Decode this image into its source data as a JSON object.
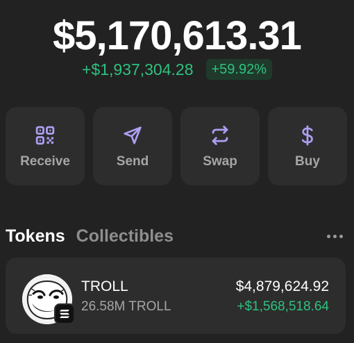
{
  "portfolio": {
    "balance": "$5,170,613.31",
    "change_abs": "+$1,937,304.28",
    "change_pct": "+59.92%"
  },
  "actions": [
    {
      "label": "Receive",
      "icon": "qr-code-icon"
    },
    {
      "label": "Send",
      "icon": "send-icon"
    },
    {
      "label": "Swap",
      "icon": "swap-icon"
    },
    {
      "label": "Buy",
      "icon": "dollar-icon"
    }
  ],
  "tabs": {
    "tokens": "Tokens",
    "collectibles": "Collectibles"
  },
  "tokens": [
    {
      "name": "TROLL",
      "amount": "26.58M TROLL",
      "value": "$4,879,624.92",
      "change": "+$1,568,518.64"
    }
  ],
  "colors": {
    "background": "#222222",
    "card": "#2d2d2d",
    "accent": "#ab9ff2",
    "positive": "#2ec27e"
  }
}
